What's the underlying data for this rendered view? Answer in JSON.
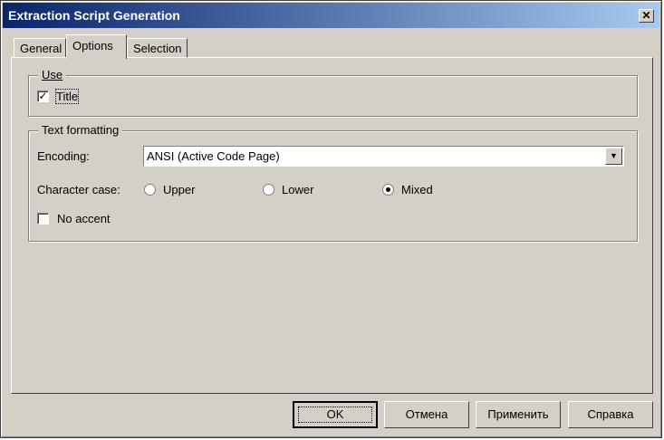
{
  "window": {
    "title": "Extraction Script Generation",
    "close_glyph": "✕"
  },
  "tabs": [
    {
      "label": "General"
    },
    {
      "label": "Options"
    },
    {
      "label": "Selection"
    }
  ],
  "use_group": {
    "legend": "Use",
    "title_checkbox": {
      "label": "Title",
      "checked": true,
      "mark": "✓"
    }
  },
  "text_formatting": {
    "legend": "Text formatting",
    "encoding_label": "Encoding:",
    "encoding_value": "ANSI (Active Code Page)",
    "dropdown_glyph": "▼",
    "character_case_label": "Character case:",
    "case_options": [
      {
        "label": "Upper",
        "selected": false
      },
      {
        "label": "Lower",
        "selected": false
      },
      {
        "label": "Mixed",
        "selected": true
      }
    ],
    "no_accent": {
      "label": "No accent",
      "checked": false
    }
  },
  "buttons": {
    "ok": "OK",
    "cancel": "Отмена",
    "apply": "Применить",
    "help": "Справка"
  }
}
